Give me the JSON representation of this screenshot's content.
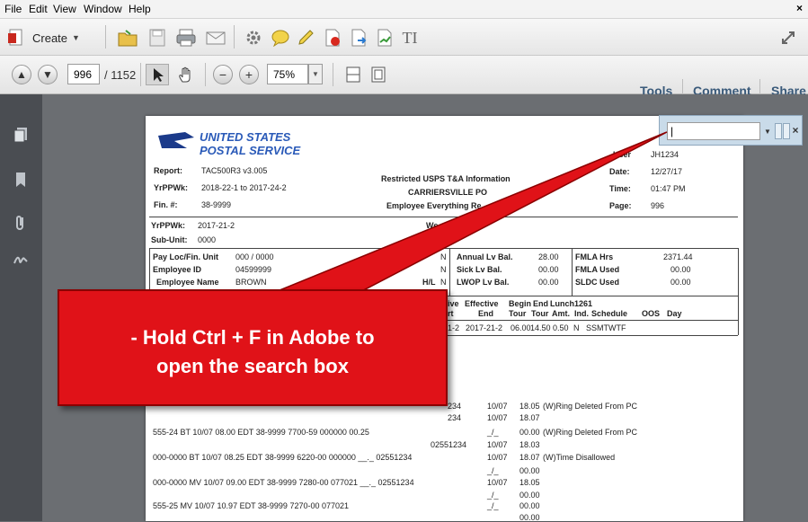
{
  "menu": {
    "items": [
      "File",
      "Edit",
      "View",
      "Window",
      "Help"
    ],
    "close": "×"
  },
  "toolbar": {
    "create_label": "Create",
    "page_current": "996",
    "page_total": "/ 1152",
    "zoom": "75%",
    "tools": "Tools",
    "comment": "Comment",
    "share": "Share"
  },
  "icons": [
    "create-icon",
    "open-folder-icon",
    "save-icon",
    "print-icon",
    "email-icon",
    "gear-icon",
    "comment-bubble-icon",
    "highlight-icon",
    "pdf-icon",
    "export-icon",
    "sign-icon",
    "text-cursor-icon",
    "page-up-icon",
    "page-down-icon",
    "select-arrow-icon",
    "hand-icon",
    "zoom-out-icon",
    "zoom-in-icon",
    "fit-page-icon",
    "fit-width-icon",
    "pages-panel-icon",
    "bookmarks-icon",
    "attachments-icon",
    "signatures-icon",
    "expand-icon"
  ],
  "search": {
    "value": "|",
    "close": "×"
  },
  "callout": {
    "line1": "- Hold Ctrl + F in Adobe to",
    "line2": "open the search box"
  },
  "doc": {
    "logo_line1": "UNITED STATES",
    "logo_line2": "POSTAL SERVICE",
    "report_label": "Report:",
    "report_value": "TAC500R3 v3.005",
    "yrppwk_label": "YrPPWk:",
    "yrppwk_value": "2018-22-1 to 2017-24-2",
    "fin_label": "Fin. #:",
    "fin_value": "38-9999",
    "center1": "Restricted USPS T&A Information",
    "center2": "CARRIERSVILLE PO",
    "center3": "Employee Everything Re",
    "user_label": "User",
    "user_value": "JH1234",
    "date_label": "Date:",
    "date_value": "12/27/17",
    "time_label": "Time:",
    "time_value": "01:47 PM",
    "page_label": "Page:",
    "page_value": "996",
    "yrppwk2_label": "YrPPWk:",
    "yrppwk2_value": "2017-21-2",
    "subunit_label": "Sub-Unit:",
    "subunit_value": "0000",
    "we_label": "We",
    "payloc_label": "Pay Loc/Fin. Unit",
    "payloc_value": "000 / 0000",
    "empid_label": "Employee ID",
    "empid_value": "04599999",
    "empname_label": "Employee Name",
    "empname_value": "BROWN",
    "hl_label": "H/L",
    "lv": [
      {
        "flag": "N",
        "label": "Annual Lv Bal.",
        "val": "28.00",
        "k2": "FMLA Hrs",
        "v2": "2371.44"
      },
      {
        "flag": "N",
        "label": "Sick Lv Bal.",
        "val": "00.00",
        "k2": "FMLA Used",
        "v2": "00.00"
      },
      {
        "flag": "N",
        "label": "LWOP Lv Bal.",
        "val": "00.00",
        "k2": "SLDC Used",
        "v2": "00.00"
      }
    ],
    "sched_h1": [
      "ive",
      "Effective",
      "Begin",
      "End",
      "Lunch",
      "1261"
    ],
    "sched_h2": [
      "rt",
      "End",
      "Tour",
      "Tour",
      "Amt.",
      "Ind.",
      "Schedule",
      "OOS",
      "Day"
    ],
    "sched_row": [
      "1-2",
      "2017-21-2",
      "06.00",
      "14.50",
      "0.50",
      "N",
      "SSMTWTF"
    ],
    "rows": [
      {
        "c1": "234",
        "c2": "10/07",
        "c3": "18.05",
        "c4": "(W)Ring Deleted From PC"
      },
      {
        "c1": "234",
        "c2": "10/07",
        "c3": "18.07",
        "c4": ""
      },
      {
        "c1": "555-24 BT 10/07 08.00 EDT 38-9999 7700-59 000000 00.25",
        "c2": "_/_",
        "c3": "00.00",
        "c4": "(W)Ring Deleted From PC"
      },
      {
        "c1": "02551234",
        "c2": "10/07",
        "c3": "18.03",
        "c4": ""
      },
      {
        "c1": "000-0000 BT 10/07 08.25 EDT 38-9999 6220-00 000000 __._ 02551234",
        "c2": "10/07",
        "c3": "18.07",
        "c4": "(W)Time Disallowed"
      },
      {
        "c1": "",
        "c2": "_/_",
        "c3": "00.00",
        "c4": ""
      },
      {
        "c1": "000-0000 MV 10/07 09.00 EDT 38-9999 7280-00 077021 __._ 02551234",
        "c2": "10/07",
        "c3": "18.05",
        "c4": ""
      },
      {
        "c1": "",
        "c2": "_/_",
        "c3": "00.00",
        "c4": ""
      },
      {
        "c1": "555-25 MV 10/07 10.97 EDT 38-9999 7270-00 077021",
        "c2": "_/_",
        "c3": "00.00",
        "c4": ""
      },
      {
        "c1": "",
        "c2": "",
        "c3": "00.00",
        "c4": ""
      }
    ]
  }
}
